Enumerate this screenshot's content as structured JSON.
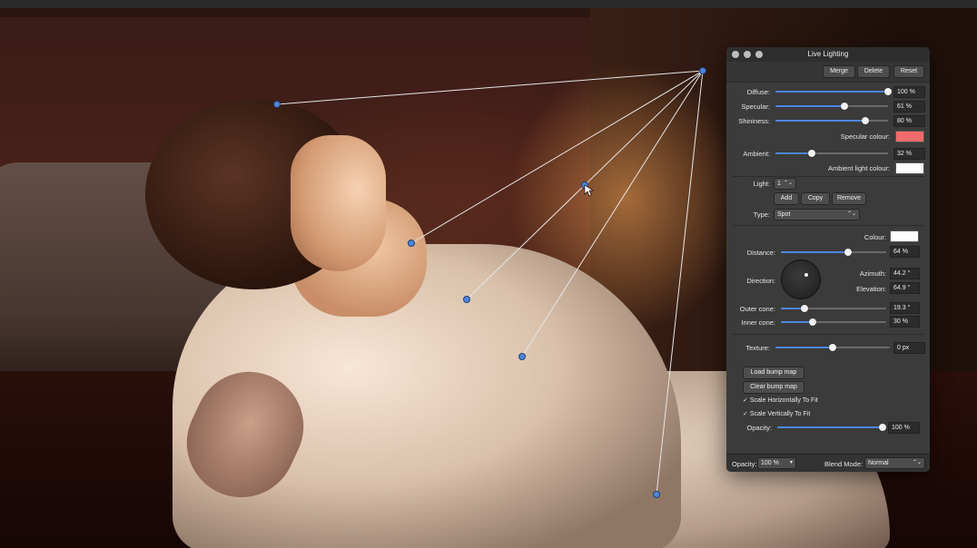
{
  "panel": {
    "title": "Live Lighting",
    "buttons": {
      "merge": "Merge",
      "delete": "Delete",
      "reset": "Reset"
    },
    "diffuse": {
      "label": "Diffuse:",
      "value": "100 %",
      "level": 1.0
    },
    "specular": {
      "label": "Specular:",
      "value": "61 %",
      "level": 0.61
    },
    "shininess": {
      "label": "Shininess:",
      "value": "80 %",
      "level": 0.8
    },
    "specular_colour": {
      "label": "Specular colour:",
      "color": "#f06b6b"
    },
    "ambient": {
      "label": "Ambient:",
      "value": "32 %",
      "level": 0.32
    },
    "ambient_colour": {
      "label": "Ambient light colour:",
      "color": "#ffffff"
    },
    "light": {
      "label": "Light:",
      "value": "1",
      "stepper": "⌃⌄"
    },
    "light_buttons": {
      "add": "Add",
      "copy": "Copy",
      "remove": "Remove"
    },
    "type": {
      "label": "Type:",
      "value": "Spot",
      "chevron": "⌃⌄"
    },
    "colour": {
      "label": "Colour:",
      "color": "#ffffff"
    },
    "distance": {
      "label": "Distance:",
      "value": "64 %",
      "level": 0.64
    },
    "direction": {
      "label": "Direction:"
    },
    "azimuth": {
      "label": "Azimuth:",
      "value": "44.2 °"
    },
    "elevation": {
      "label": "Elevation:",
      "value": "64.9 °"
    },
    "outer_cone": {
      "label": "Outer cone:",
      "value": "19.3 °",
      "level": 0.22
    },
    "inner_cone": {
      "label": "Inner cone:",
      "value": "30 %",
      "level": 0.3
    },
    "texture": {
      "label": "Texture:",
      "value": "0 px",
      "level": 0.5
    },
    "load_bump": "Load bump map",
    "clear_bump": "Clear bump map",
    "scale_h": {
      "check": "✓",
      "label": "Scale Horizontally To Fit"
    },
    "scale_v": {
      "check": "✓",
      "label": "Scale Vertically To Fit"
    },
    "opacity": {
      "label": "Opacity:",
      "value": "100 %",
      "level": 1.0
    },
    "bottom": {
      "opacity_label": "Opacity:",
      "opacity_value": "100 %",
      "blend_label": "Blend Mode:",
      "blend_value": "Normal",
      "chevron": "⌃⌄"
    }
  },
  "accent": "#4c86e0"
}
